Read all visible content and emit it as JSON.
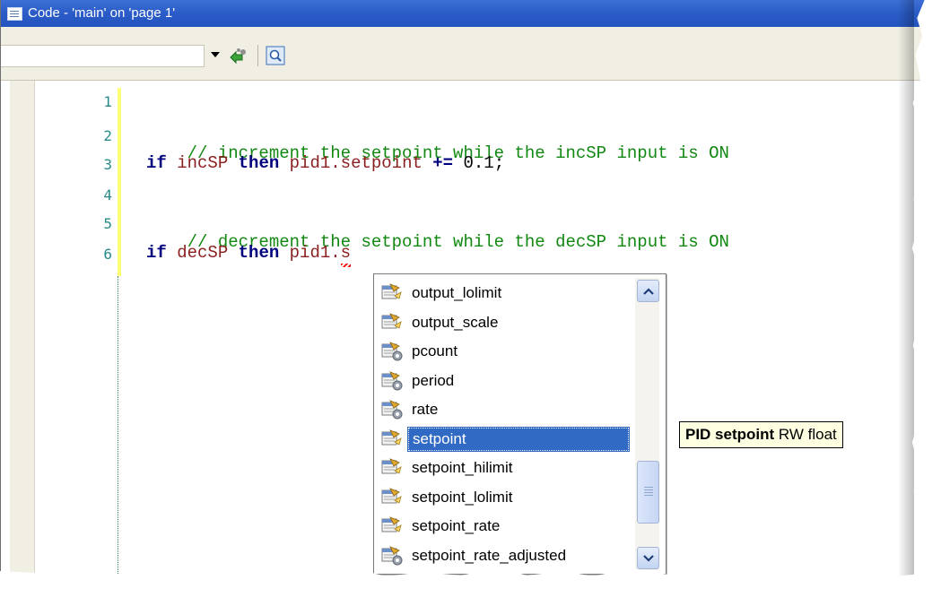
{
  "window": {
    "title": "Code - 'main' on 'page 1'"
  },
  "toolbar": {
    "combo_value": "",
    "buttons": [
      {
        "name": "compile-arrow-icon"
      },
      {
        "name": "find-icon"
      }
    ]
  },
  "editor": {
    "line_numbers": [
      "1",
      "2",
      "3",
      "4",
      "5",
      "6"
    ],
    "lines": {
      "l2": {
        "comment": "// increment the setpoint while the incSP input is ON"
      },
      "l3": {
        "kw_if": "if",
        "cond": " incSP ",
        "kw_then": "then",
        "target": " pid1.setpoint ",
        "op": "+=",
        "rest": " 0.1;"
      },
      "l5": {
        "comment": "// decrement the setpoint while the decSP input is ON"
      },
      "l6": {
        "kw_if": "if",
        "cond": " decSP ",
        "kw_then": "then",
        "target": " pid1.",
        "typed": "s"
      }
    }
  },
  "autocomplete": {
    "items": [
      {
        "label": "output_lolimit",
        "icon": "property-rw-icon"
      },
      {
        "label": "output_scale",
        "icon": "property-rw-icon"
      },
      {
        "label": "pcount",
        "icon": "property-ro-icon"
      },
      {
        "label": "period",
        "icon": "property-ro-icon"
      },
      {
        "label": "rate",
        "icon": "property-ro-icon"
      },
      {
        "label": "setpoint",
        "icon": "property-rw-icon",
        "selected": true
      },
      {
        "label": "setpoint_hilimit",
        "icon": "property-rw-icon"
      },
      {
        "label": "setpoint_lolimit",
        "icon": "property-rw-icon"
      },
      {
        "label": "setpoint_rate",
        "icon": "property-rw-icon"
      },
      {
        "label": "setpoint_rate_adjusted",
        "icon": "property-ro-icon"
      }
    ]
  },
  "tooltip": {
    "bold": "PID setpoint",
    "rest": " RW float"
  },
  "colors": {
    "titlebar": "#2a5bc7",
    "selection": "#316ac5",
    "comment": "#118811",
    "keyword": "#00007f",
    "identifier": "#8b1e1e",
    "line_number": "#2a8a8a"
  }
}
